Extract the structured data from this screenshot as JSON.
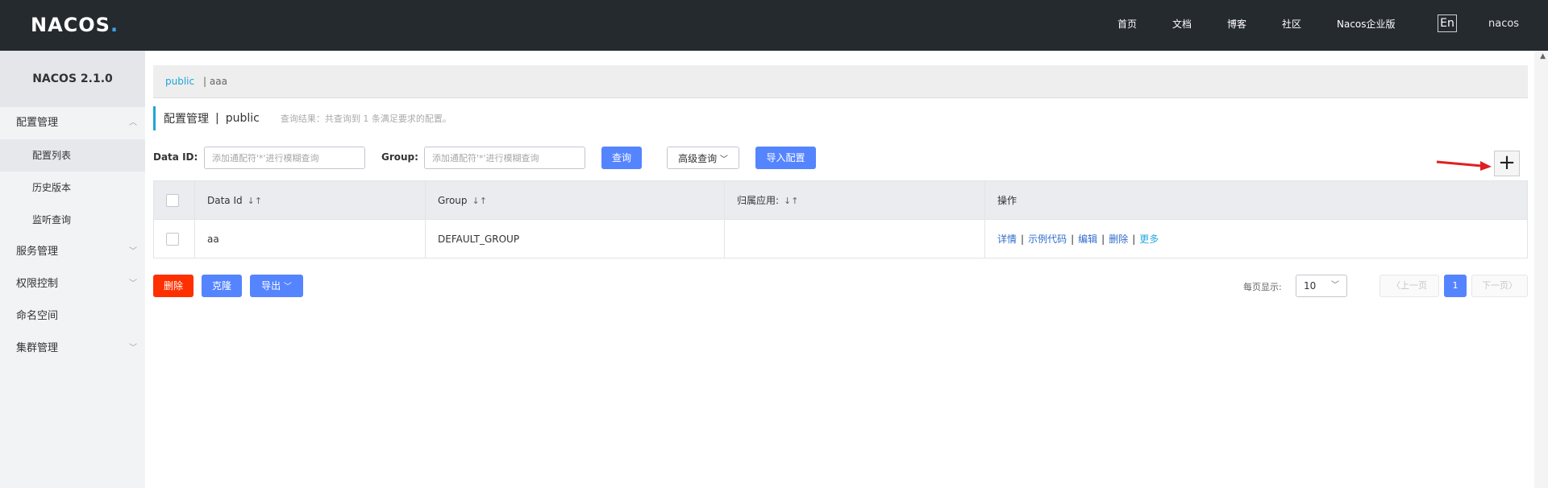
{
  "header": {
    "logo": "NACOS",
    "nav": [
      "首页",
      "文档",
      "博客",
      "社区",
      "Nacos企业版"
    ],
    "lang": "En",
    "user": "nacos"
  },
  "sidebar": {
    "title": "NACOS 2.1.0",
    "items": [
      {
        "label": "配置管理"
      },
      {
        "label": "配置列表"
      },
      {
        "label": "历史版本"
      },
      {
        "label": "监听查询"
      },
      {
        "label": "服务管理"
      },
      {
        "label": "权限控制"
      },
      {
        "label": "命名空间"
      },
      {
        "label": "集群管理"
      }
    ]
  },
  "namespace_bar": {
    "active": "public",
    "other": "| aaa"
  },
  "page_header": {
    "title": "配置管理",
    "sep": "|",
    "namespace": "public",
    "result": "查询结果：共查询到 1 条满足要求的配置。"
  },
  "filters": {
    "dataid_label": "Data ID:",
    "dataid_placeholder": "添加通配符'*'进行模糊查询",
    "group_label": "Group:",
    "group_placeholder": "添加通配符'*'进行模糊查询",
    "query_btn": "查询",
    "advanced_btn": "高级查询",
    "import_btn": "导入配置",
    "add_btn": "+"
  },
  "table": {
    "columns": [
      "Data Id",
      "Group",
      "归属应用:",
      "操作"
    ],
    "rows": [
      {
        "data_id": "aa",
        "group": "DEFAULT_GROUP",
        "app": "",
        "ops": [
          "详情",
          "示例代码",
          "编辑",
          "删除",
          "更多"
        ]
      }
    ]
  },
  "batch": {
    "delete": "删除",
    "clone": "克隆",
    "export": "导出"
  },
  "pagination": {
    "label": "每页显示:",
    "page_size": "10",
    "prev": "上一页",
    "current": "1",
    "next": "下一页"
  },
  "colors": {
    "topbar": "#252a2f",
    "primary": "#5584ff",
    "danger": "#ff3000",
    "accent": "#1fa4d9"
  }
}
